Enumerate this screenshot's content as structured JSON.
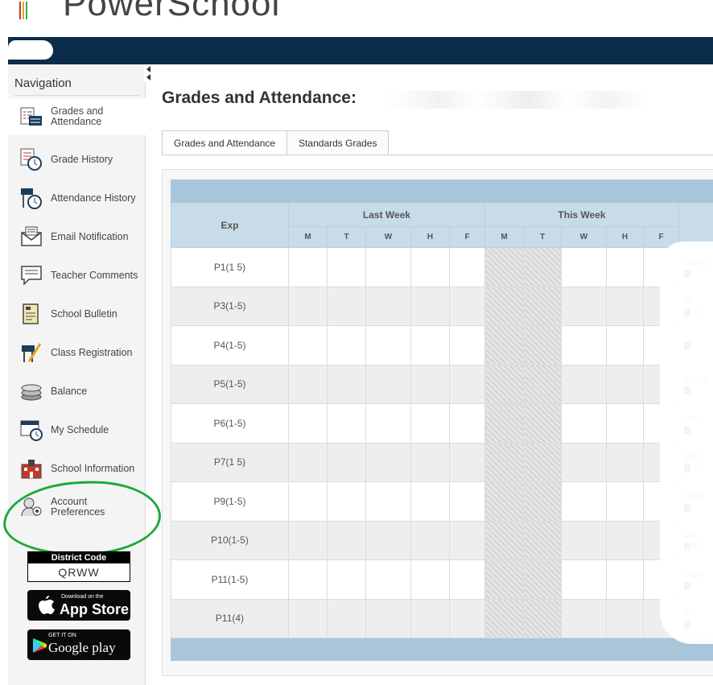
{
  "app": {
    "logo_text": "PowerSchool"
  },
  "navigation": {
    "title": "Navigation",
    "items": [
      {
        "label": "Grades and Attendance",
        "icon": "grades-attendance-icon",
        "active": true
      },
      {
        "label": "Grade History",
        "icon": "grade-history-icon"
      },
      {
        "label": "Attendance History",
        "icon": "attendance-history-icon"
      },
      {
        "label": "Email Notification",
        "icon": "email-icon"
      },
      {
        "label": "Teacher Comments",
        "icon": "comment-icon"
      },
      {
        "label": "School Bulletin",
        "icon": "bulletin-icon"
      },
      {
        "label": "Class Registration",
        "icon": "registration-icon"
      },
      {
        "label": "Balance",
        "icon": "coins-icon"
      },
      {
        "label": "My Schedule",
        "icon": "schedule-icon"
      },
      {
        "label": "School Information",
        "icon": "school-icon"
      },
      {
        "label": "Account Preferences",
        "icon": "account-icon"
      }
    ]
  },
  "district": {
    "label": "District Code",
    "code": "QRWW"
  },
  "stores": {
    "apple_small": "Download on the",
    "apple_big": "App Store",
    "google_small": "GET IT ON",
    "google_big": "Google play"
  },
  "page": {
    "title": "Grades and Attendance:"
  },
  "tabs": [
    "Grades and Attendance",
    "Standards Grades"
  ],
  "table": {
    "exp_header": "Exp",
    "last_week": "Last Week",
    "this_week": "This Week",
    "days": [
      "M",
      "T",
      "W",
      "H",
      "F",
      "M",
      "T",
      "W",
      "H",
      "F"
    ],
    "rows": [
      {
        "exp": "P1(1 5)",
        "course": "Home",
        "course_sub": ""
      },
      {
        "exp": "P3(1-5)",
        "course": "Ar",
        "course_sub": "En"
      },
      {
        "exp": "P4(1-5)",
        "course": "",
        "course_sub": ""
      },
      {
        "exp": "P5(1-5)",
        "course": "angua",
        "course_sub": ""
      },
      {
        "exp": "P6(1-5)",
        "course": "Lanı",
        "course_sub": ""
      },
      {
        "exp": "P7(1 5)",
        "course": "ther",
        "course_sub": "En"
      },
      {
        "exp": "P9(1-5)",
        "course": "Sciei",
        "course_sub": ""
      },
      {
        "exp": "P10(1-5)",
        "course": "Sc",
        "course_sub": "Er"
      },
      {
        "exp": "P11(1-5)",
        "course": "L ary",
        "course_sub": ""
      },
      {
        "exp": "P11(4)",
        "course": "nv",
        "course_sub": ""
      }
    ]
  },
  "colors": {
    "topnav": "#0b2c4a",
    "table_header": "#c8dbe9",
    "highlight": "#1fa83a"
  }
}
